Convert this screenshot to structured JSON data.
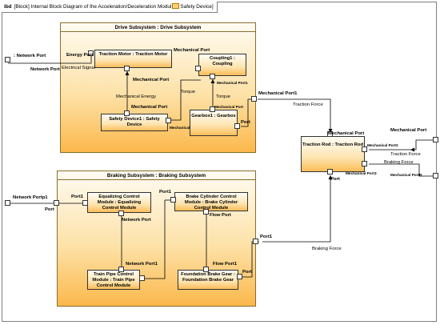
{
  "frame": {
    "kind": "ibd",
    "title_prefix": "[Block] Internal Block Diagram of the Acceleration/Deceleration Modul",
    "title_suffix": "Safety Device]"
  },
  "drive": {
    "title": "Drive Subsystem : Drive Subsystem",
    "traction_motor": "Traction Motor : Traction Motor",
    "coupling": "Coupling1 : Coupling",
    "gearbox": "Gearbox1 : Gearbox",
    "safety_device": "Safety Device1 : Safety Device",
    "energy_port": "Energy Port",
    "electrical_signal": "Electrical Signal",
    "mech_port_top": "Mechanical Port",
    "mech_port_motor": "Mechanical Port",
    "mechanical_energy": "Mechanical Energy",
    "mech_port_safety": "Mechanical Port",
    "torque_left": "Torque",
    "torque_right": "Torque",
    "mech_port1_coupling": "Mechanical Port1",
    "mech_port_gearbox": "Mechanical Port",
    "mech_port_small": "Mechanical",
    "port": "Port"
  },
  "network_port": ": Network Port",
  "network_port_inner": "Network Port",
  "mech_port1_out": "Mechanical Port1",
  "traction_force": "Traction Force",
  "traction_rod": {
    "name": "Traction Rod : Traction Rod",
    "mech_port": "Mechanical Port",
    "mech_port2": "Mechanical Port2",
    "mech_port3": "Mechanical Port3",
    "port": "Port"
  },
  "right": {
    "mech_port": "Mechanical Port",
    "traction_force": "Traction Force",
    "braking_force": "Braking Force",
    "mech_port_b": "Mechanical PortB"
  },
  "braking": {
    "title": "Braking Subsystem : Braking Subsystem",
    "equalizing": "Equalizing Control Module : Equalizing Control Module",
    "brake_cylinder": "Brake Cylinder Control Module : Brake Cylinder Control Module",
    "train_pipe": "Train Pipe Control Module : Train Pipe Control Module",
    "foundation": "Foundation Brake Gear : Foundation Brake Gear",
    "port1_eq": "Port1",
    "port_eq": "Port",
    "network_port_eq": "Network Port",
    "port1_bc": "Port1",
    "flow_port": "Flow Port",
    "network_port1_tp": "Network Port1",
    "flow_port1": "Flow Port1",
    "port_fb": "Port",
    "port1_out": "Port1"
  },
  "network_portp1": "Network Portp1",
  "braking_force": "Braking Force"
}
